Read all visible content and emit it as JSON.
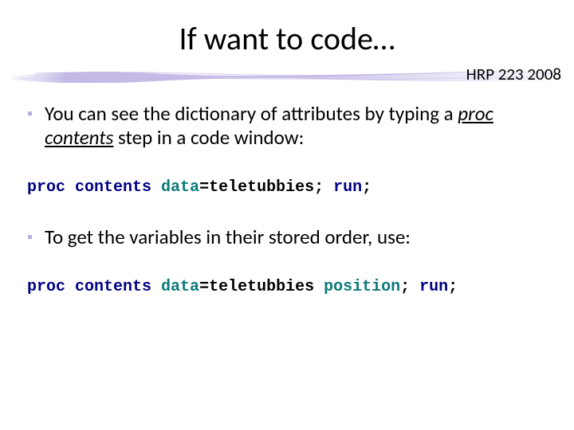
{
  "title": "If want to code…",
  "course_tag": "HRP 223 2008",
  "bullets": {
    "b1_pre": "You can see the dictionary of attributes by typing a ",
    "b1_em": "proc contents",
    "b1_post": " step in a code window:",
    "b2": "To get the variables in their stored order, use:"
  },
  "code": {
    "line1": {
      "proc": "proc ",
      "contents": "contents ",
      "data_kw": "data",
      "data_rest": "=teletubbies; ",
      "run": "run",
      "semi": ";"
    },
    "line2": {
      "proc": "proc ",
      "contents": "contents ",
      "data_kw": "data",
      "data_rest": "=teletubbies ",
      "position": "position",
      "semi1": "; ",
      "run": "run",
      "semi2": ";"
    }
  },
  "glyphs": {
    "square": "▪"
  }
}
